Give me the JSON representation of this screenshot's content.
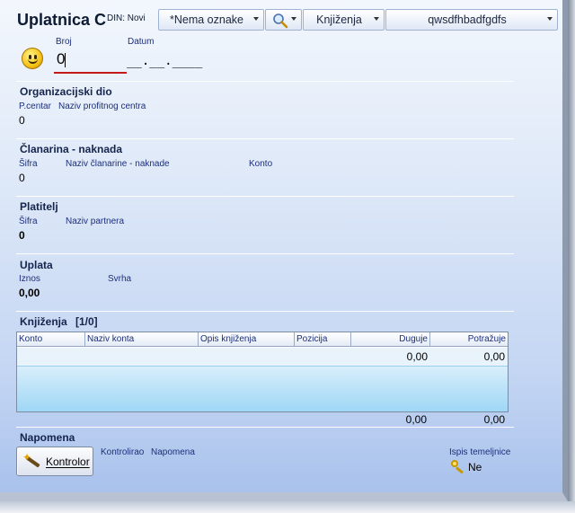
{
  "header": {
    "title": "Uplatnica C",
    "din_status": "DIN: Novi",
    "oznake_combo": "*Nema oznake",
    "knjizenja_combo": "Knjiženja",
    "text_combo": "qwsdfhbadfgdfs",
    "search_icon": "magnifier-icon"
  },
  "document": {
    "broj_label": "Broj",
    "broj_value": "0",
    "datum_label": "Datum",
    "datum_value": "__.__.____"
  },
  "organizacijski_dio": {
    "title": "Organizacijski dio",
    "pcentar_label": "P.centar",
    "naziv_label": "Naziv profitnog centra",
    "pcentar_value": "0"
  },
  "clanarina": {
    "title": "Članarina - naknada",
    "sifra_label": "Šifra",
    "naziv_label": "Naziv članarine - naknade",
    "konto_label": "Konto",
    "sifra_value": "0"
  },
  "platitelj": {
    "title": "Platitelj",
    "sifra_label": "Šifra",
    "naziv_label": "Naziv partnera",
    "sifra_value": "0"
  },
  "uplata": {
    "title": "Uplata",
    "iznos_label": "Iznos",
    "svrha_label": "Svrha",
    "iznos_value": "0,00"
  },
  "knjizenja": {
    "title": "Knjiženja",
    "counter": "[1/0]",
    "columns": [
      "Konto",
      "Naziv konta",
      "Opis knjiženja",
      "Pozicija",
      "Duguje",
      "Potražuje"
    ],
    "row": {
      "duguje": "0,00",
      "potrazuje": "0,00"
    },
    "totals": {
      "duguje": "0,00",
      "potrazuje": "0,00"
    }
  },
  "napomena": {
    "title": "Napomena",
    "kontrolor_button": "Kontrolor",
    "kontrolirao_label": "Kontrolirao",
    "napomena_label": "Napomena",
    "ispis_label": "Ispis temeljnice",
    "ispis_value": "Ne"
  },
  "colors": {
    "section_title": "#14244d",
    "label": "#1c2f7a",
    "broj_underline": "#c41919",
    "grid_fill": "#9ed7f5"
  }
}
